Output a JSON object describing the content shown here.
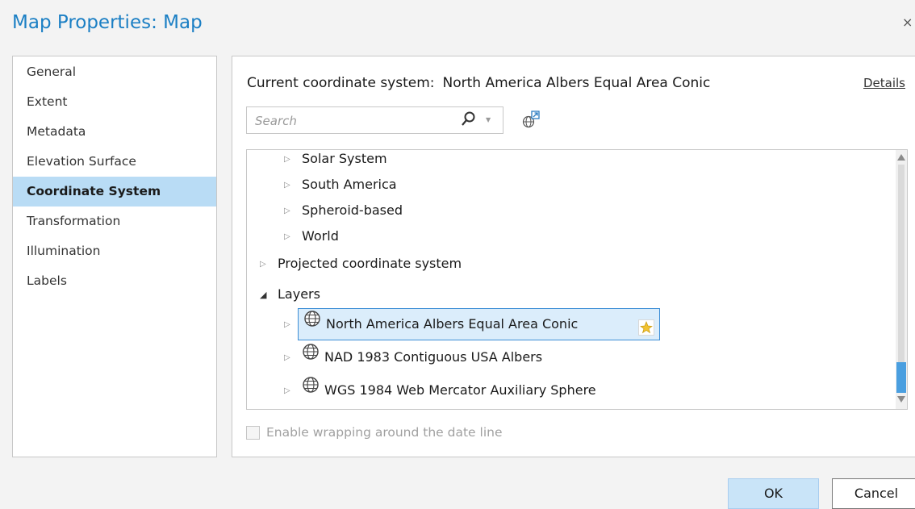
{
  "window": {
    "title": "Map Properties: Map",
    "close_glyph": "×"
  },
  "sidebar": {
    "items": [
      {
        "label": "General",
        "active": false
      },
      {
        "label": "Extent",
        "active": false
      },
      {
        "label": "Metadata",
        "active": false
      },
      {
        "label": "Elevation Surface",
        "active": false
      },
      {
        "label": "Coordinate System",
        "active": true
      },
      {
        "label": "Transformation",
        "active": false
      },
      {
        "label": "Illumination",
        "active": false
      },
      {
        "label": "Labels",
        "active": false
      }
    ]
  },
  "coordinate_system": {
    "current_label": "Current coordinate system:",
    "current_value": "North America Albers Equal Area Conic",
    "details_link": "Details"
  },
  "search": {
    "placeholder": "Search",
    "value": ""
  },
  "tree": {
    "nodes": [
      {
        "label": "Solar System",
        "level": 1,
        "state": "collapsed",
        "icon": null
      },
      {
        "label": "South America",
        "level": 1,
        "state": "collapsed",
        "icon": null
      },
      {
        "label": "Spheroid-based",
        "level": 1,
        "state": "collapsed",
        "icon": null
      },
      {
        "label": "World",
        "level": 1,
        "state": "collapsed",
        "icon": null
      },
      {
        "label": "Projected coordinate system",
        "level": 0,
        "state": "collapsed",
        "icon": null
      },
      {
        "label": "Layers",
        "level": 0,
        "state": "expanded",
        "icon": null
      },
      {
        "label": "North America Albers Equal Area Conic",
        "level": 1,
        "state": "collapsed",
        "icon": "globe-icon",
        "selected": true
      },
      {
        "label": "NAD 1983 Contiguous USA Albers",
        "level": 1,
        "state": "collapsed",
        "icon": "globe-icon"
      },
      {
        "label": "WGS 1984 Web Mercator Auxiliary Sphere",
        "level": 1,
        "state": "collapsed",
        "icon": "globe-icon"
      }
    ]
  },
  "options": {
    "wrap_label": "Enable wrapping around the date line",
    "wrap_checked": false,
    "wrap_enabled": false
  },
  "buttons": {
    "ok": "OK",
    "cancel": "Cancel"
  },
  "colors": {
    "title": "#1b7fc4",
    "active_item": "#b9dcf5",
    "selection_border": "#3c8ed6",
    "ok_button": "#c9e4f8"
  }
}
